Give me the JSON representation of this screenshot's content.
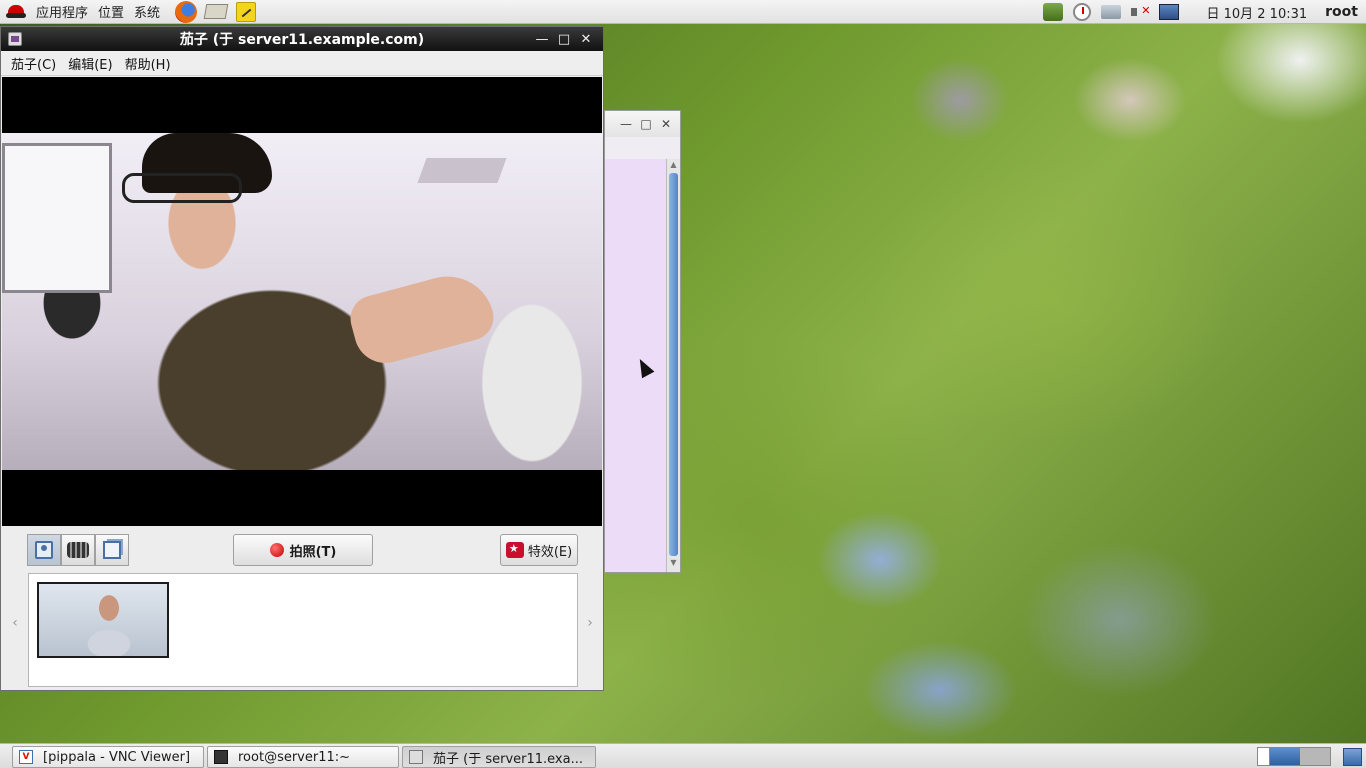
{
  "top_panel": {
    "menus": [
      "应用程序",
      "位置",
      "系统"
    ],
    "launchers": [
      "firefox-icon",
      "mail-icon",
      "notes-icon"
    ],
    "tray_icons": [
      "update-icon",
      "clock-icon",
      "network-icon",
      "volume-muted-icon",
      "monitor-icon"
    ],
    "clock": "日 10月  2 10:31",
    "user": "root"
  },
  "cheese_window": {
    "title": "茄子 (于 server11.example.com)",
    "menus": [
      "茄子(C)",
      "编辑(E)",
      "帮助(H)"
    ],
    "mode_buttons": [
      "photo-mode",
      "video-mode",
      "burst-mode"
    ],
    "take_photo_label": "拍照(T)",
    "effects_label": "特效(E)",
    "thumbnails_count_label": ""
  },
  "taskbar": {
    "tasks": [
      {
        "label": "[pippala - VNC Viewer]",
        "icon": "vnc-icon"
      },
      {
        "label": "root@server11:~",
        "icon": "terminal-icon"
      },
      {
        "label": "茄子 (于 server11.exa...",
        "icon": "cheese-icon"
      }
    ]
  },
  "colors": {
    "titlebar": "#1a1a1a",
    "terminal_bg": "#eddcf7",
    "workspace_active": "#3e70b2",
    "record": "#c40000"
  }
}
